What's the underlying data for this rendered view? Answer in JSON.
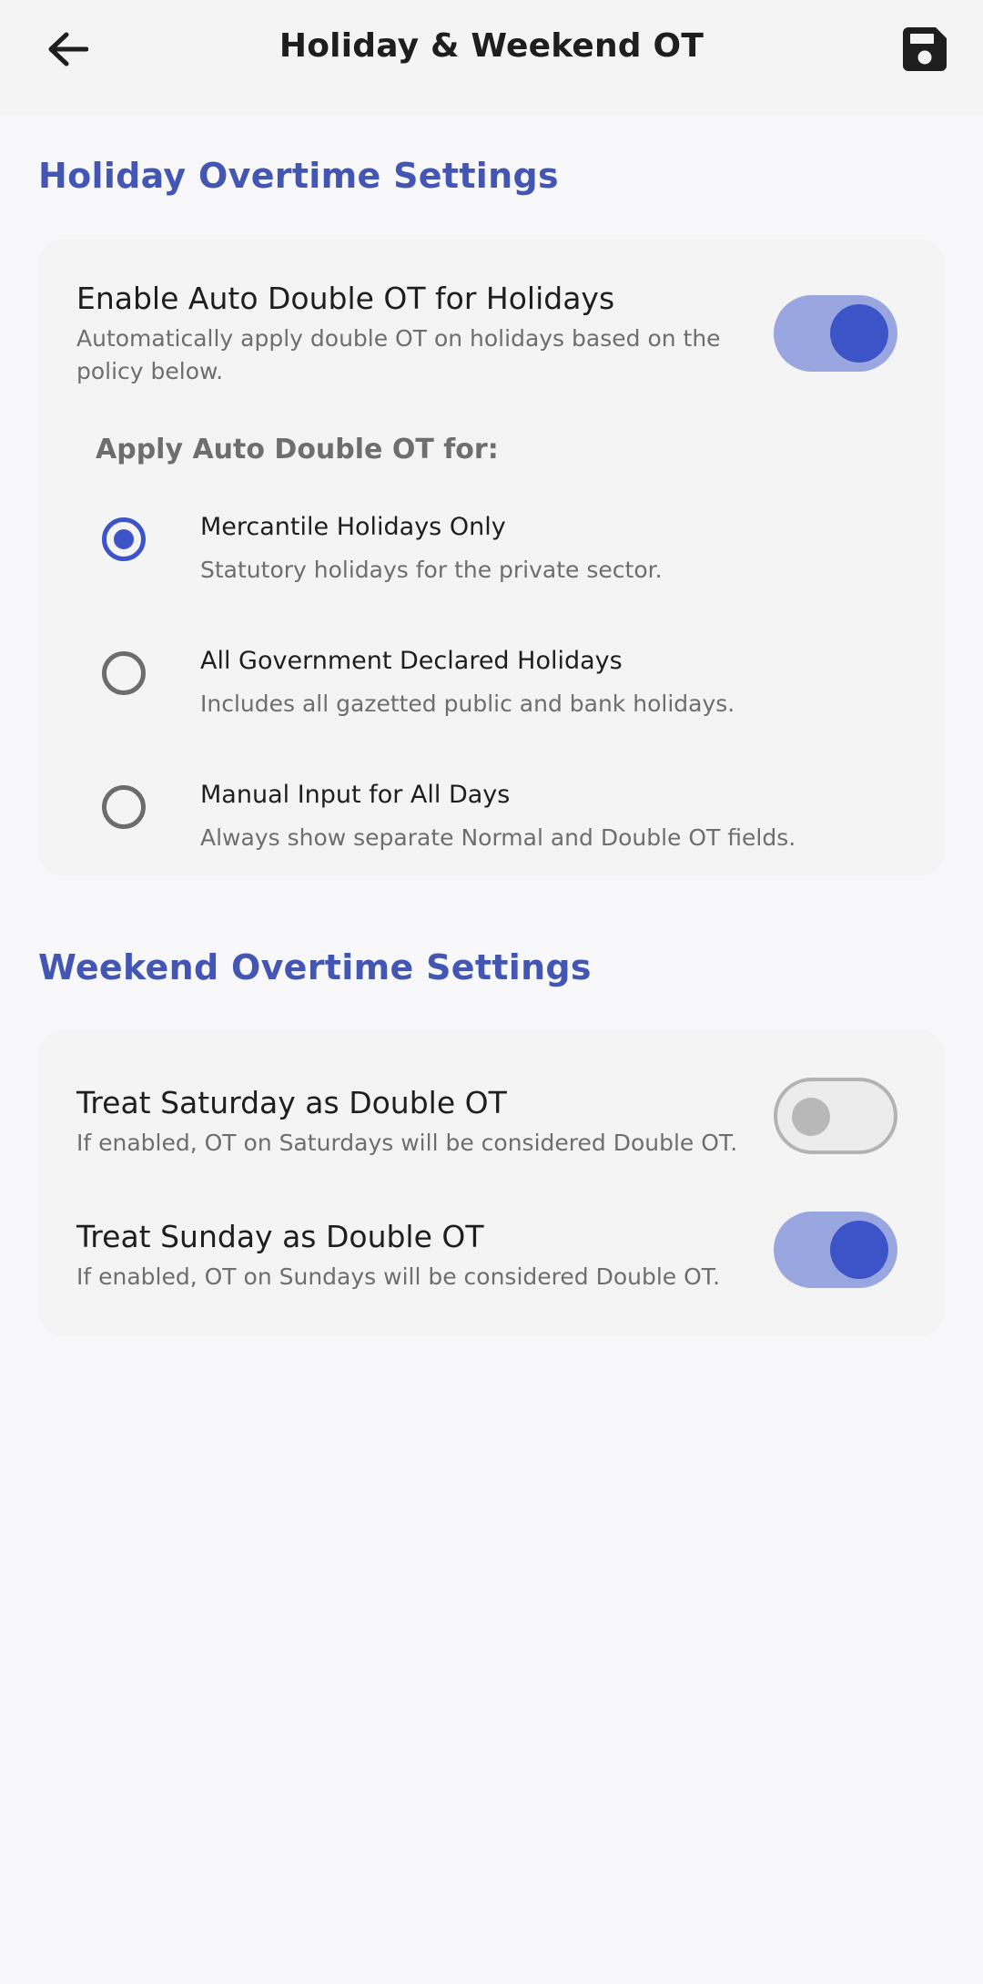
{
  "appbar": {
    "title": "Holiday & Weekend OT",
    "back_icon": "arrow-left-icon",
    "save_icon": "floppy-disk-icon"
  },
  "holiday": {
    "section_title": "Holiday Overtime Settings",
    "auto_toggle": {
      "title": "Enable Auto Double OT for Holidays",
      "subtitle": "Automatically apply double OT on holidays based on the policy below.",
      "enabled": true
    },
    "apply_label": "Apply Auto Double OT for:",
    "options": [
      {
        "title": "Mercantile Holidays Only",
        "subtitle": "Statutory holidays for the private sector.",
        "selected": true
      },
      {
        "title": "All Government Declared Holidays",
        "subtitle": "Includes all gazetted public and bank holidays.",
        "selected": false
      },
      {
        "title": "Manual Input for All Days",
        "subtitle": "Always show separate Normal and Double OT fields.",
        "selected": false
      }
    ]
  },
  "weekend": {
    "section_title": "Weekend Overtime Settings",
    "saturday": {
      "title": "Treat Saturday as Double OT",
      "subtitle": "If enabled, OT on Saturdays will be considered Double OT.",
      "enabled": false
    },
    "sunday": {
      "title": "Treat Sunday as Double OT",
      "subtitle": "If enabled, OT on Sundays will be considered Double OT.",
      "enabled": true
    }
  },
  "colors": {
    "accent": "#3d53c8",
    "section_title": "#4356b4",
    "toggle_track_on": "#9aa6e0"
  }
}
